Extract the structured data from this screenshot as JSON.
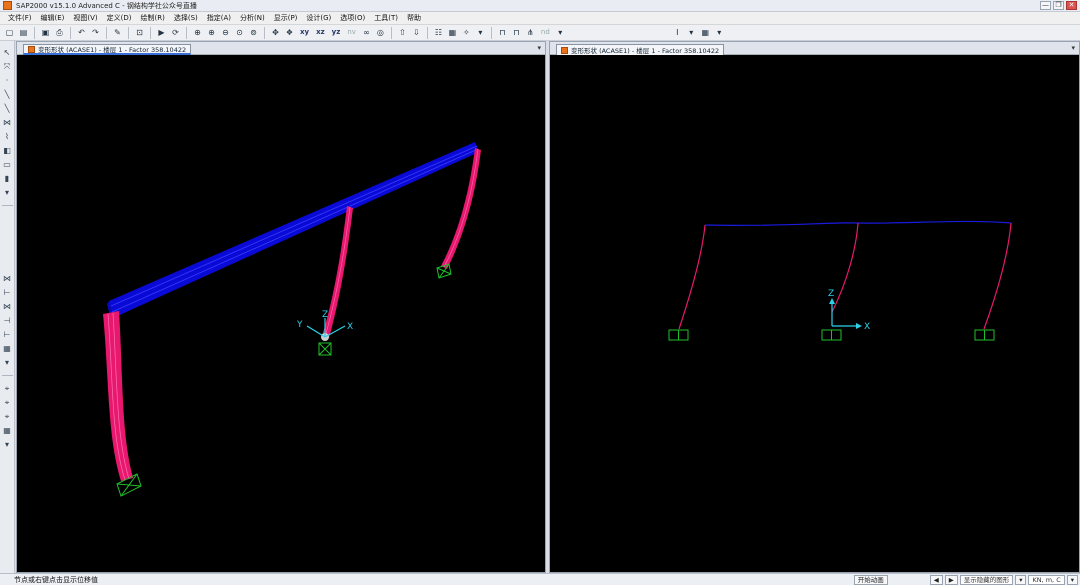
{
  "window": {
    "title": "SAP2000 v15.1.0 Advanced C - 钢结构学社公众号直播",
    "controls": [
      "—",
      "❐",
      "✕"
    ]
  },
  "menu": {
    "items": [
      "文件(F)",
      "编辑(E)",
      "视图(V)",
      "定义(D)",
      "绘制(R)",
      "选择(S)",
      "指定(A)",
      "分析(N)",
      "显示(P)",
      "设计(G)",
      "选项(O)",
      "工具(T)",
      "帮助"
    ]
  },
  "toolbar": {
    "view_xy": "xy",
    "view_xz": "xz",
    "view_yz": "yz",
    "view_nv": "nv",
    "view_nd": "nd"
  },
  "left_pane": {
    "tab_title": "变形形状 (ACASE1) - 楼层 1 - Factor 358.10422",
    "axes": {
      "x": "X",
      "y": "Y",
      "z": "Z"
    }
  },
  "right_pane": {
    "tab_title": "变形形状 (ACASE1) - 楼层 1 - Factor 358.10422",
    "axes": {
      "x": "X",
      "z": "Z"
    }
  },
  "colors": {
    "beam": "#0a0ad6",
    "column": "#e8186e",
    "support": "#1fbf2a",
    "axis": "#2bd3ea",
    "background": "#000000"
  },
  "status": {
    "hint": "节点或右键点击显示位移值",
    "start_animation": "开始动画",
    "display_option": "显示隐藏的图形",
    "units": "KN, m, C"
  }
}
